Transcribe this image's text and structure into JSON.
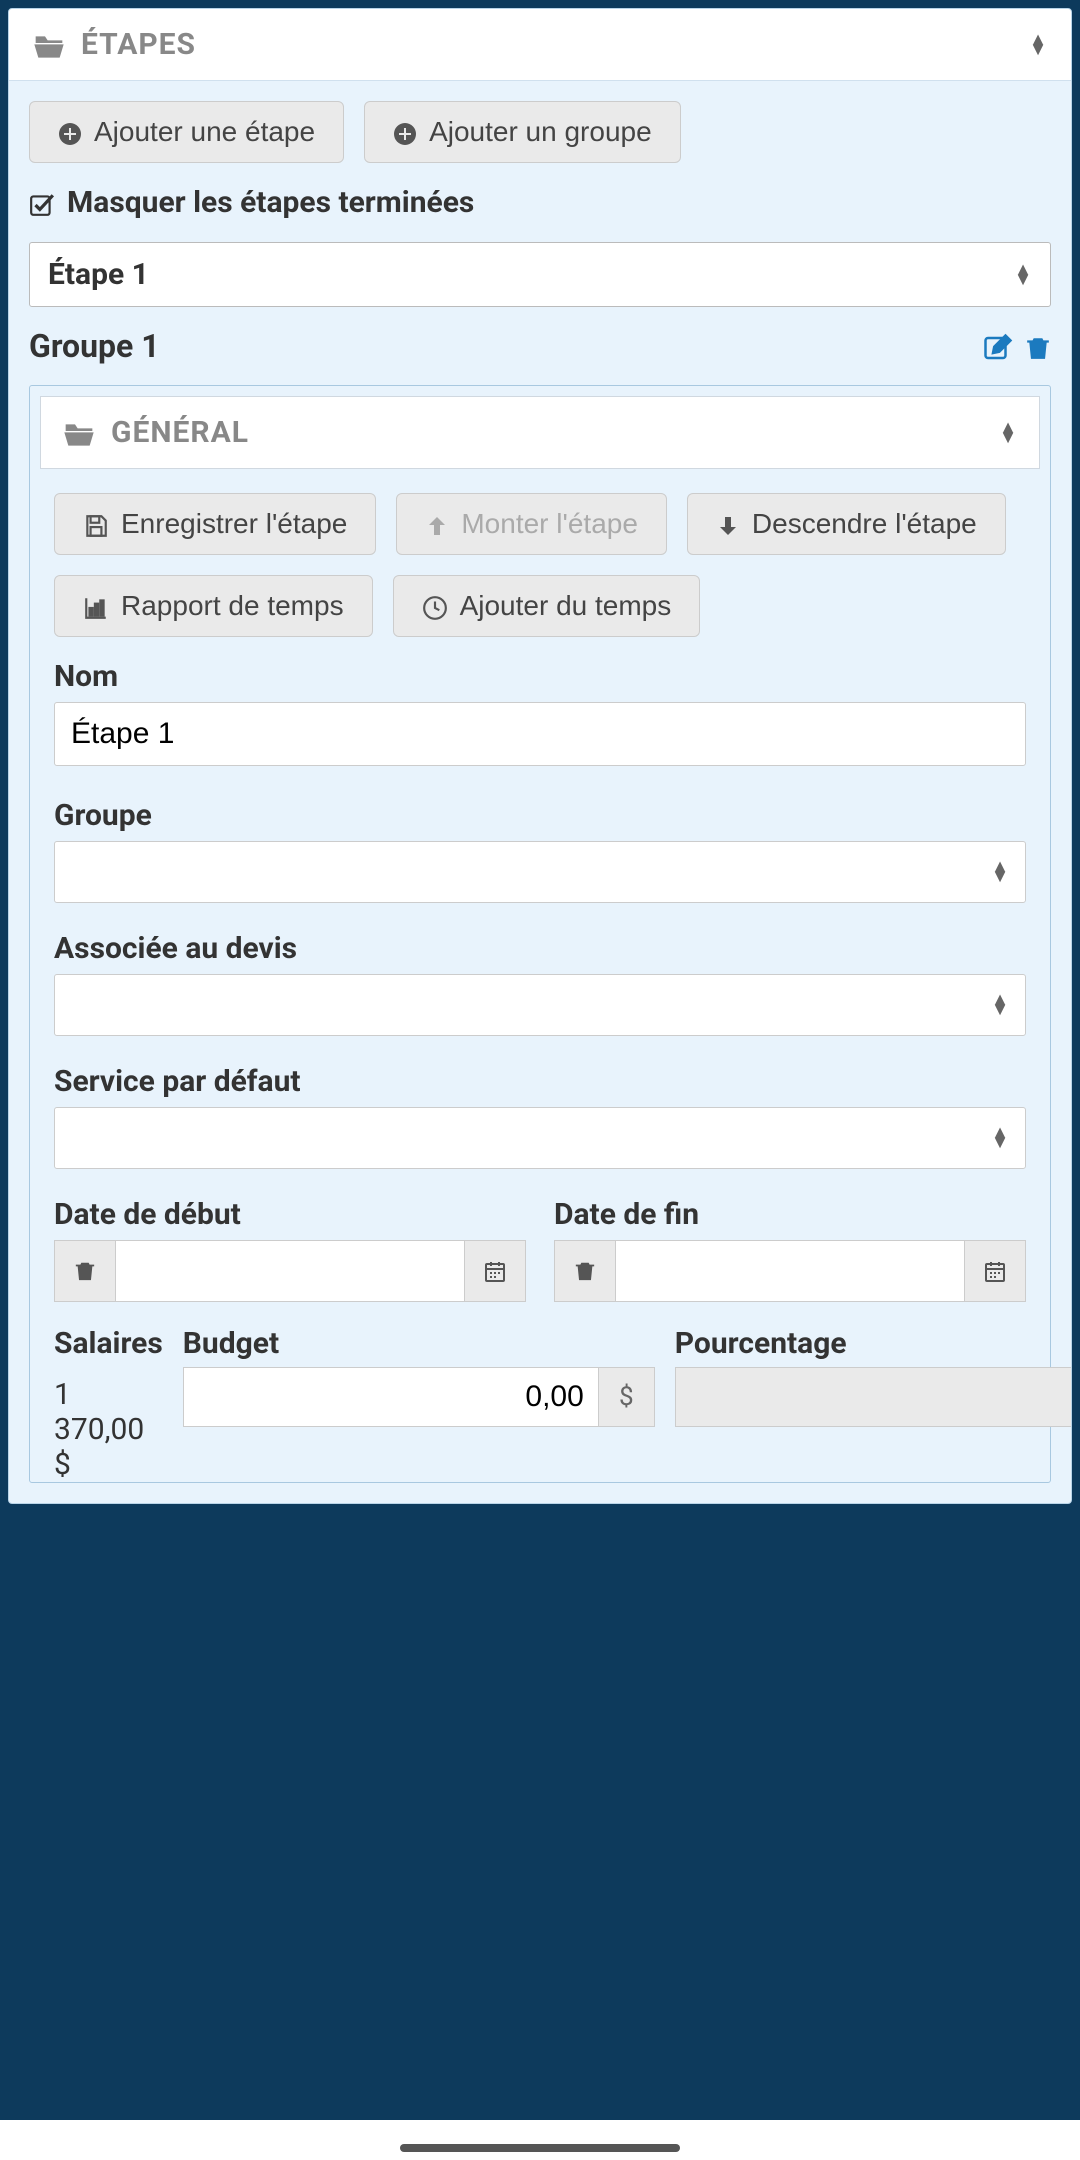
{
  "etapes_panel": {
    "title": "ÉTAPES",
    "add_step_label": "Ajouter une étape",
    "add_group_label": "Ajouter un groupe",
    "hide_completed_label": "Masquer les étapes terminées",
    "step_select_value": "Étape 1",
    "group_label": "Groupe 1"
  },
  "general_panel": {
    "title": "GÉNÉRAL",
    "save_label": "Enregistrer l'étape",
    "move_up_label": "Monter l'étape",
    "move_down_label": "Descendre l'étape",
    "time_report_label": "Rapport de temps",
    "add_time_label": "Ajouter du temps",
    "fields": {
      "name_label": "Nom",
      "name_value": "Étape 1",
      "group_label": "Groupe",
      "quote_label": "Associée au devis",
      "service_label": "Service par défaut",
      "start_date_label": "Date de début",
      "end_date_label": "Date de fin",
      "salary_label": "Salaires",
      "salary_value": "1 370,00 $",
      "budget_label": "Budget",
      "budget_value": "0,00",
      "percent_label": "Pourcentage",
      "dollar_symbol": "$",
      "percent_symbol": "%"
    }
  }
}
